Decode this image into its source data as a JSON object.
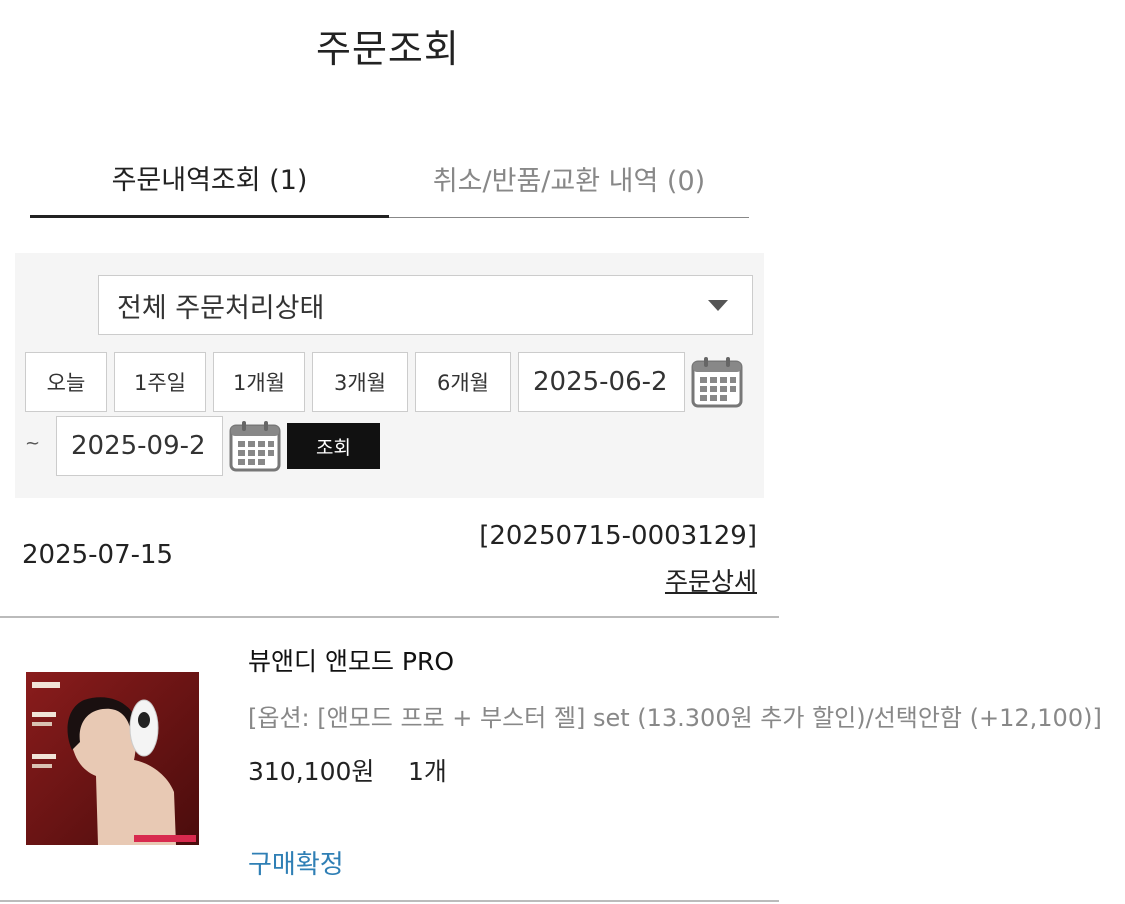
{
  "header": {
    "title": "주문조회"
  },
  "tabs": [
    {
      "label": "주문내역조회 (1)",
      "active": true
    },
    {
      "label": "취소/반품/교환 내역 (0)",
      "active": false
    }
  ],
  "filter": {
    "status_select": {
      "value": "전체 주문처리상태",
      "icon": "chevron-down-icon"
    },
    "period_buttons": [
      "오늘",
      "1주일",
      "1개월",
      "3개월",
      "6개월"
    ],
    "start_date": "2025-06-2",
    "end_date": "2025-09-2",
    "range_separator": "~",
    "search_label": "조회",
    "calendar_icon": "calendar-icon"
  },
  "order": {
    "date": "2025-07-15",
    "number": "[20250715-0003129]",
    "detail_link": "주문상세",
    "item": {
      "name": "뷰앤디 앤모드 PRO",
      "option": "[옵션: [앤모드 프로 + 부스터 젤] set (13.300원 추가 할인)/선택안함 (+12,100)]",
      "price": "310,100원",
      "quantity": "1개",
      "status": "구매확정"
    }
  },
  "colors": {
    "accent_link": "#2f7fb5",
    "search_button_bg": "#111111",
    "filter_panel_bg": "#f5f5f5"
  }
}
